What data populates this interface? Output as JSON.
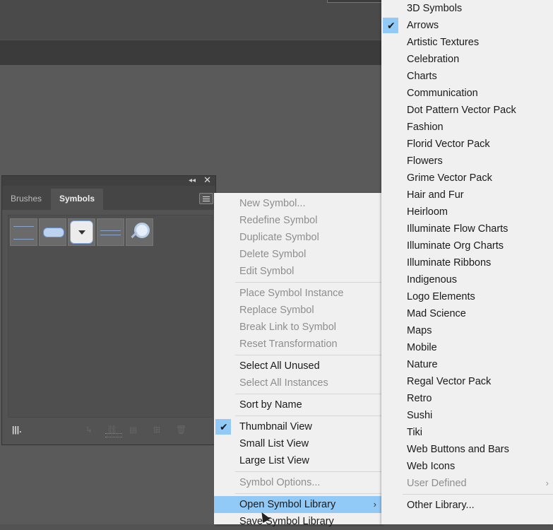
{
  "panel": {
    "tabs": [
      {
        "label": "Brushes"
      },
      {
        "label": "Symbols"
      }
    ]
  },
  "menu": {
    "items": [
      {
        "label": "New Symbol..."
      },
      {
        "label": "Redefine Symbol"
      },
      {
        "label": "Duplicate Symbol"
      },
      {
        "label": "Delete Symbol"
      },
      {
        "label": "Edit Symbol"
      },
      {
        "label": "Place Symbol Instance"
      },
      {
        "label": "Replace Symbol"
      },
      {
        "label": "Break Link to Symbol"
      },
      {
        "label": "Reset Transformation"
      },
      {
        "label": "Select All Unused"
      },
      {
        "label": "Select All Instances"
      },
      {
        "label": "Sort by Name"
      },
      {
        "label": "Thumbnail View"
      },
      {
        "label": "Small List View"
      },
      {
        "label": "Large List View"
      },
      {
        "label": "Symbol Options..."
      },
      {
        "label": "Open Symbol Library"
      },
      {
        "label": "Save Symbol Library"
      }
    ]
  },
  "submenu": {
    "items": [
      {
        "label": "3D Symbols"
      },
      {
        "label": "Arrows"
      },
      {
        "label": "Artistic Textures"
      },
      {
        "label": "Celebration"
      },
      {
        "label": "Charts"
      },
      {
        "label": "Communication"
      },
      {
        "label": "Dot Pattern Vector Pack"
      },
      {
        "label": "Fashion"
      },
      {
        "label": "Florid Vector Pack"
      },
      {
        "label": "Flowers"
      },
      {
        "label": "Grime Vector Pack"
      },
      {
        "label": "Hair and Fur"
      },
      {
        "label": "Heirloom"
      },
      {
        "label": "Illuminate Flow Charts"
      },
      {
        "label": "Illuminate Org Charts"
      },
      {
        "label": "Illuminate Ribbons"
      },
      {
        "label": "Indigenous"
      },
      {
        "label": "Logo Elements"
      },
      {
        "label": "Mad Science"
      },
      {
        "label": "Maps"
      },
      {
        "label": "Mobile"
      },
      {
        "label": "Nature"
      },
      {
        "label": "Regal Vector Pack"
      },
      {
        "label": "Retro"
      },
      {
        "label": "Sushi"
      },
      {
        "label": "Tiki"
      },
      {
        "label": "Web Buttons and Bars"
      },
      {
        "label": "Web Icons"
      },
      {
        "label": "User Defined"
      },
      {
        "label": "Other Library..."
      }
    ]
  }
}
